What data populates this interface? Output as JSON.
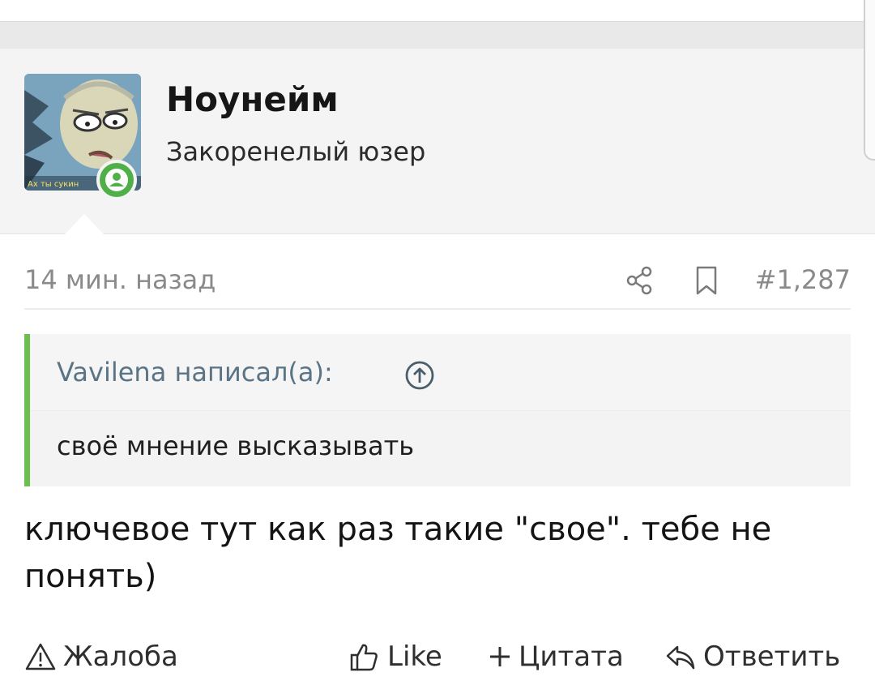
{
  "user": {
    "name": "Ноунейм",
    "title": "Закоренелый юзер",
    "avatar_caption": "Ах ты сукин"
  },
  "post": {
    "time": "14 мин. назад",
    "number": "#1,287",
    "quote": {
      "author_line": "Vavilena написал(а):",
      "text": "своё мнение высказывать"
    },
    "message": "ключевое тут как раз такие \"свое\". тебе не понять)"
  },
  "actions": {
    "report": "Жалоба",
    "like": "Like",
    "quote": "Цитата",
    "reply": "Ответить"
  },
  "icons": {
    "share": "share-icon",
    "bookmark": "bookmark-icon",
    "jump": "arrow-up-circle-icon",
    "online": "user-online-icon",
    "report": "warning-icon",
    "like": "thumbs-up-icon",
    "quote": "plus-icon",
    "reply": "reply-icon"
  },
  "colors": {
    "accent_green": "#6cbf4e",
    "online_green": "#4fb04a",
    "quote_author": "#5a7486",
    "meta_gray": "#8a8a8a"
  }
}
